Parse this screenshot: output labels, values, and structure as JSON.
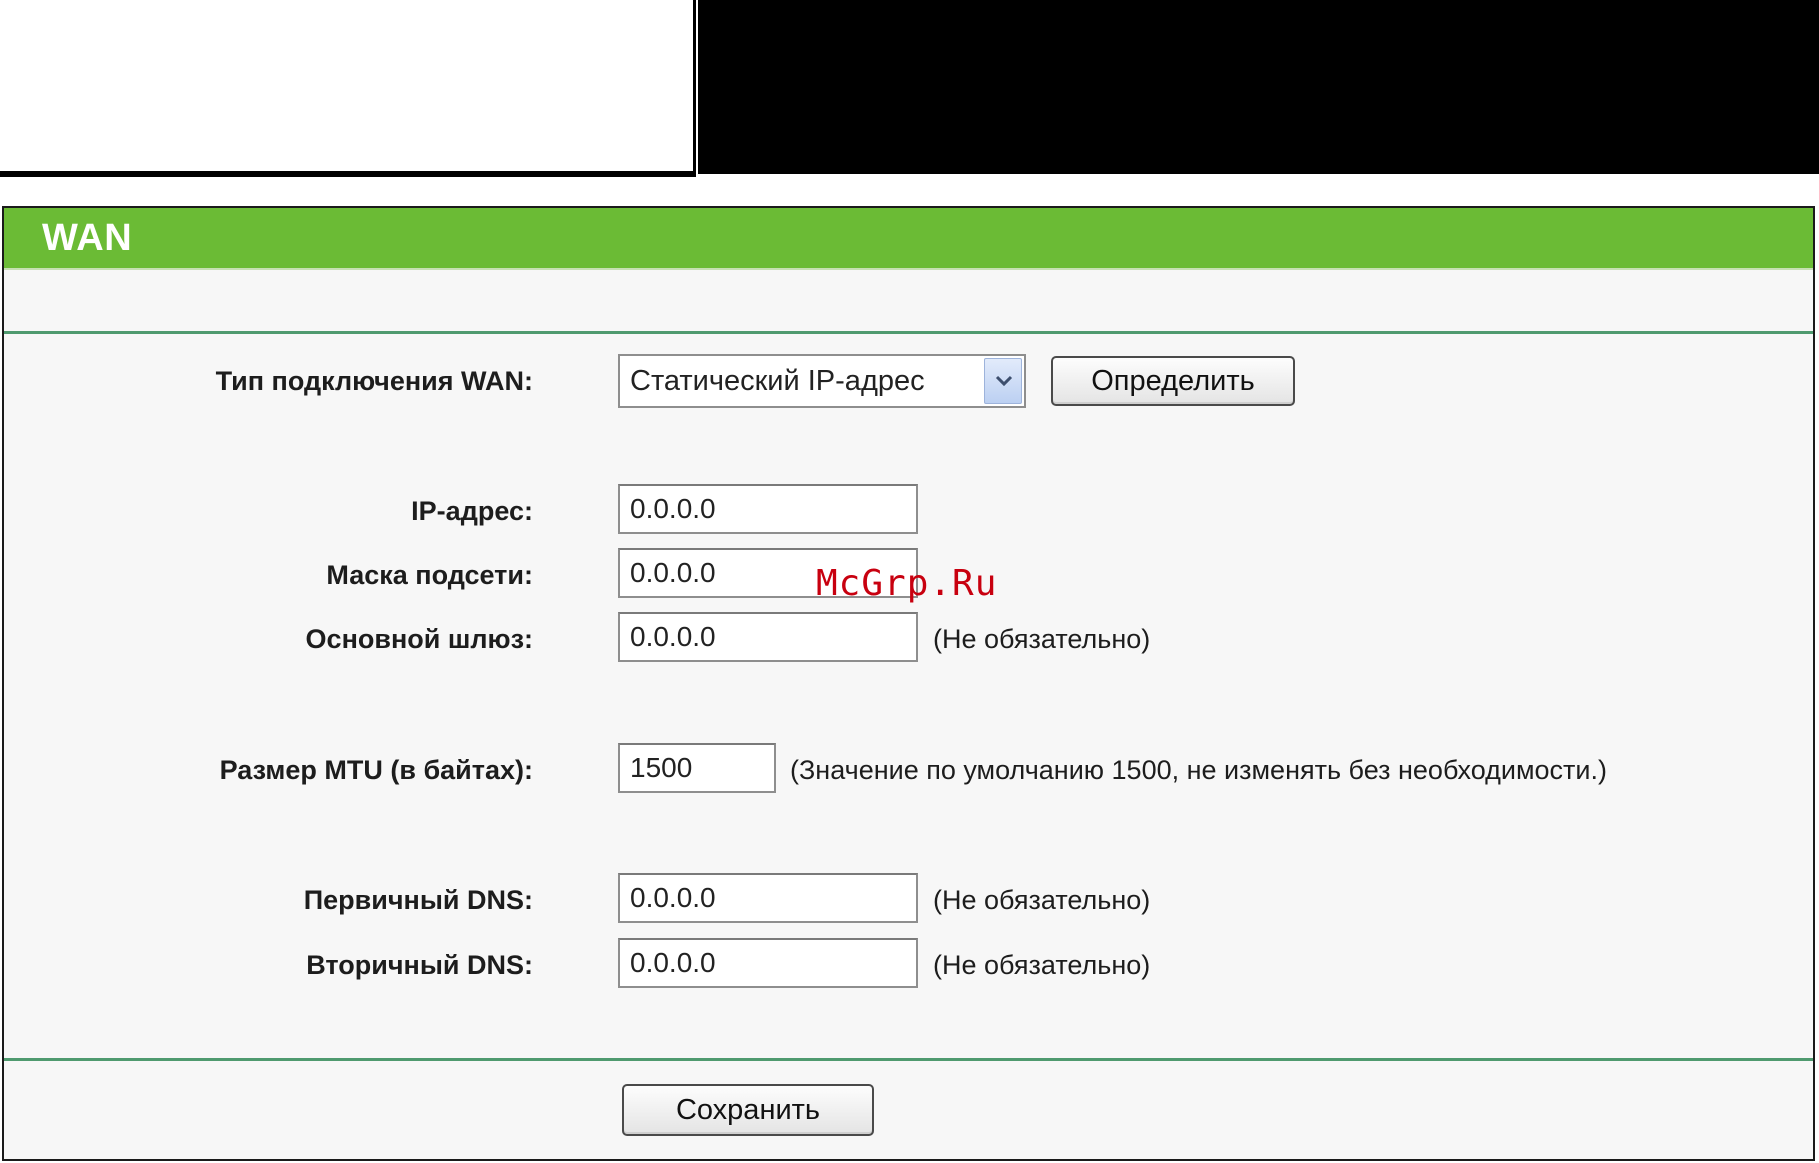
{
  "panel": {
    "title": "WAN"
  },
  "form": {
    "connection_type_label": "Тип подключения WAN:",
    "connection_type_value": "Статический IP-адрес",
    "detect_button": "Определить",
    "ip_label": "IP-адрес:",
    "ip_value": "0.0.0.0",
    "mask_label": "Маска подсети:",
    "mask_value": "0.0.0.0",
    "gateway_label": "Основной шлюз:",
    "gateway_value": "0.0.0.0",
    "gateway_hint": "(Не обязательно)",
    "mtu_label": "Размер MTU (в байтах):",
    "mtu_value": "1500",
    "mtu_hint": "(Значение по умолчанию 1500, не изменять без необходимости.)",
    "dns1_label": "Первичный DNS:",
    "dns1_value": "0.0.0.0",
    "dns1_hint": "(Не обязательно)",
    "dns2_label": "Вторичный DNS:",
    "dns2_value": "0.0.0.0",
    "dns2_hint": "(Не обязательно)",
    "save_button": "Сохранить"
  },
  "watermark": "McGrp.Ru",
  "icons": {
    "select_arrow": "chevron-down-icon"
  },
  "colors": {
    "header_green": "#6bbb35",
    "divider_green": "#4f9a6f",
    "watermark_red": "#c8000f"
  }
}
